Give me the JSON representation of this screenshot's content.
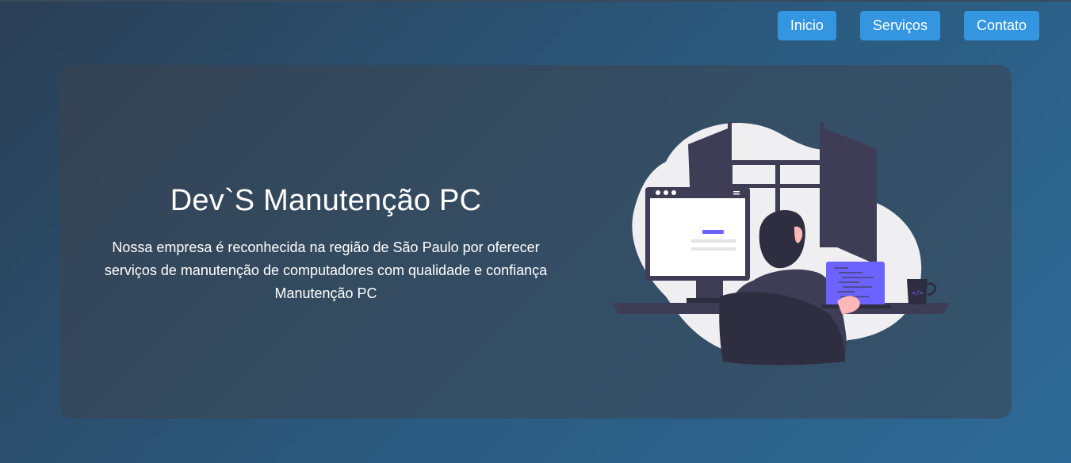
{
  "nav": {
    "items": [
      {
        "label": "Inicio"
      },
      {
        "label": "Serviços"
      },
      {
        "label": "Contato"
      }
    ]
  },
  "hero": {
    "title": "Dev`S Manutenção PC",
    "description": "Nossa empresa é reconhecida na região de São Paulo por oferecer serviços de manutenção de computadores com qualidade e confiança Manutenção PC"
  },
  "illustration": {
    "icon": "developer-at-desk-illustration",
    "accent_color": "#6c63ff"
  },
  "colors": {
    "nav_button": "#3496e0",
    "background_start": "#2b3f55",
    "background_end": "#2e6a97"
  }
}
